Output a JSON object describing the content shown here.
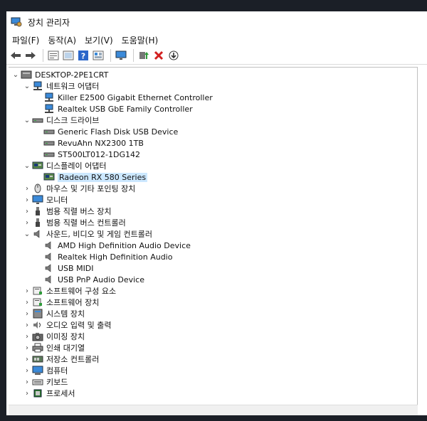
{
  "window": {
    "title": "장치 관리자"
  },
  "menu": [
    "파일(F)",
    "동작(A)",
    "보기(V)",
    "도움말(H)"
  ],
  "toolbar": [
    "back-icon",
    "forward-icon",
    "properties-icon",
    "list-icon",
    "help-icon",
    "view-icon",
    "monitor-icon",
    "update-driver-icon",
    "uninstall-icon",
    "download-icon"
  ],
  "colors": {
    "selection": "#cce8ff",
    "accent": "#0078d7"
  },
  "tree": {
    "root": "DESKTOP-2PE1CRT",
    "rows": [
      {
        "label": "네트워크 어댑터",
        "level": 1,
        "exp": "open",
        "icon": "network-icon"
      },
      {
        "label": "Killer E2500 Gigabit Ethernet Controller",
        "level": 2,
        "icon": "network-icon"
      },
      {
        "label": "Realtek USB GbE Family Controller",
        "level": 2,
        "icon": "network-icon"
      },
      {
        "label": "디스크 드라이브",
        "level": 1,
        "exp": "open",
        "icon": "disk-icon"
      },
      {
        "label": "Generic Flash Disk USB Device",
        "level": 2,
        "icon": "disk-icon"
      },
      {
        "label": "RevuAhn NX2300 1TB",
        "level": 2,
        "icon": "disk-icon"
      },
      {
        "label": "ST500LT012-1DG142",
        "level": 2,
        "icon": "disk-icon"
      },
      {
        "label": "디스플레이 어댑터",
        "level": 1,
        "exp": "open",
        "icon": "display-icon"
      },
      {
        "label": "Radeon RX 580 Series",
        "level": 2,
        "icon": "display-icon",
        "selected": true
      },
      {
        "label": "마우스 및 기타 포인팅 장치",
        "level": 1,
        "exp": "closed",
        "icon": "mouse-icon"
      },
      {
        "label": "모니터",
        "level": 1,
        "exp": "closed",
        "icon": "monitor-icon"
      },
      {
        "label": "범용 직렬 버스 장치",
        "level": 1,
        "exp": "closed",
        "icon": "usb-icon"
      },
      {
        "label": "범용 직렬 버스 컨트롤러",
        "level": 1,
        "exp": "closed",
        "icon": "usb-icon"
      },
      {
        "label": "사운드, 비디오 및 게임 컨트롤러",
        "level": 1,
        "exp": "open",
        "icon": "speaker-icon"
      },
      {
        "label": "AMD High Definition Audio Device",
        "level": 2,
        "icon": "speaker-icon"
      },
      {
        "label": "Realtek High Definition Audio",
        "level": 2,
        "icon": "speaker-icon"
      },
      {
        "label": "USB MIDI",
        "level": 2,
        "icon": "speaker-icon"
      },
      {
        "label": "USB PnP Audio Device",
        "level": 2,
        "icon": "speaker-icon"
      },
      {
        "label": "소프트웨어 구성 요소",
        "level": 1,
        "exp": "closed",
        "icon": "software-icon"
      },
      {
        "label": "소프트웨어 장치",
        "level": 1,
        "exp": "closed",
        "icon": "software-icon"
      },
      {
        "label": "시스템 장치",
        "level": 1,
        "exp": "closed",
        "icon": "system-icon"
      },
      {
        "label": "오디오 입력 및 출력",
        "level": 1,
        "exp": "closed",
        "icon": "audio-io-icon"
      },
      {
        "label": "이미징 장치",
        "level": 1,
        "exp": "closed",
        "icon": "camera-icon"
      },
      {
        "label": "인쇄 대기열",
        "level": 1,
        "exp": "closed",
        "icon": "printer-icon"
      },
      {
        "label": "저장소 컨트롤러",
        "level": 1,
        "exp": "closed",
        "icon": "storage-icon"
      },
      {
        "label": "컴퓨터",
        "level": 1,
        "exp": "closed",
        "icon": "computer-icon"
      },
      {
        "label": "키보드",
        "level": 1,
        "exp": "closed",
        "icon": "keyboard-icon"
      },
      {
        "label": "프로세서",
        "level": 1,
        "exp": "closed",
        "icon": "processor-icon"
      }
    ]
  }
}
